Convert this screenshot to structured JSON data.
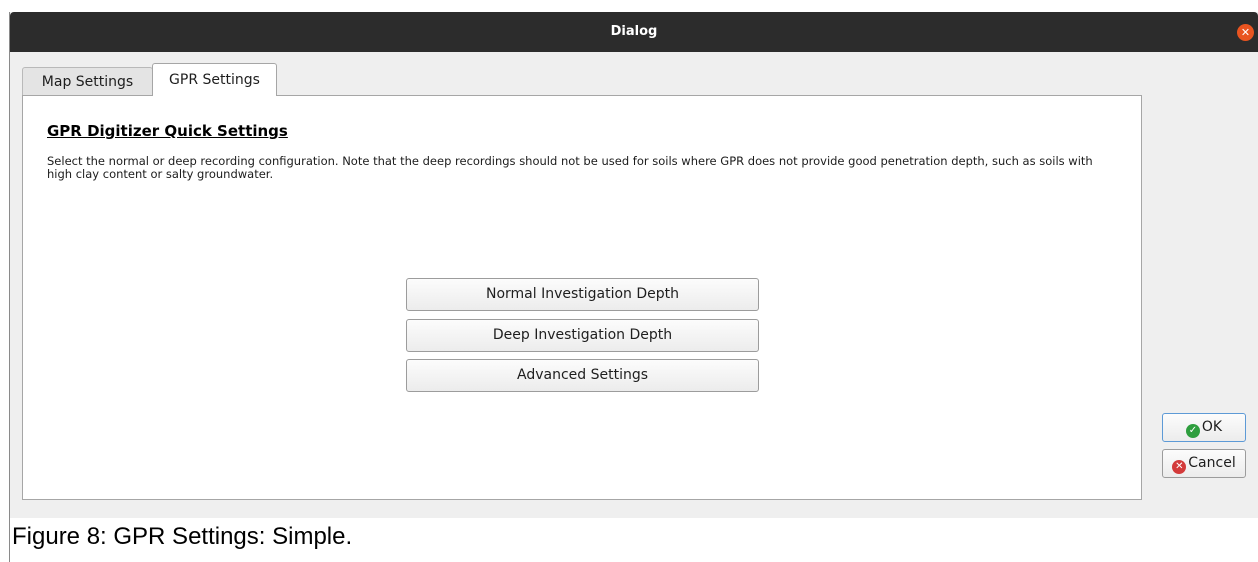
{
  "window": {
    "title": "Dialog",
    "close_icon": "✕"
  },
  "tabs": [
    {
      "label": "Map Settings",
      "active": false
    },
    {
      "label": "GPR Settings",
      "active": true
    }
  ],
  "panel": {
    "heading": "GPR Digitizer Quick Settings",
    "description": "Select the normal or deep recording configuration. Note that the deep recordings should not be used for soils where GPR does not provide good penetration depth, such as soils with high clay content or salty groundwater.",
    "buttons": [
      {
        "label": "Normal Investigation Depth"
      },
      {
        "label": "Deep Investigation Depth"
      },
      {
        "label": "Advanced Settings"
      }
    ]
  },
  "dialog_buttons": {
    "ok_label": "OK",
    "ok_icon": "check-circle-icon",
    "cancel_label": "Cancel",
    "cancel_icon": "x-circle-icon"
  },
  "caption": "Figure 8: GPR Settings: Simple.",
  "colors": {
    "titlebar": "#2c2c2c",
    "close_button": "#e95420",
    "ok_icon": "#2e9e3e",
    "cancel_icon": "#d33a3a"
  }
}
